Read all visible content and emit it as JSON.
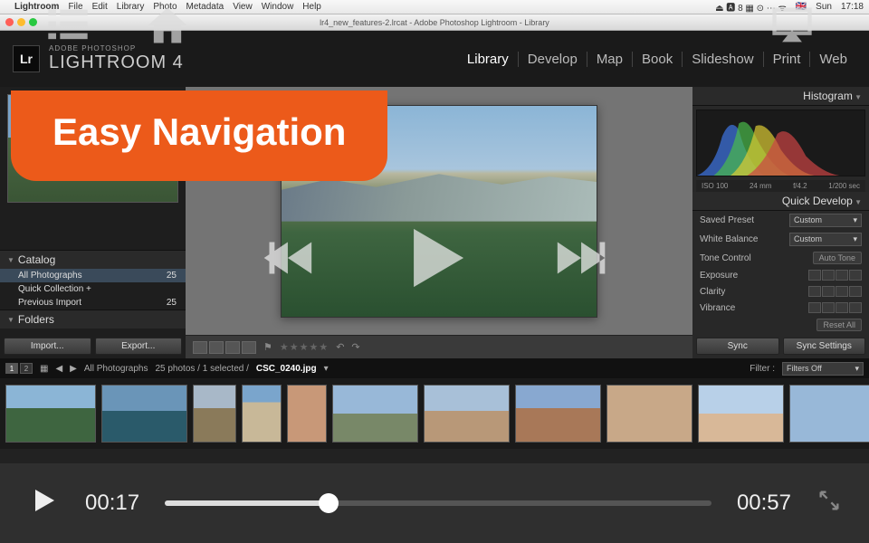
{
  "mac_menu": {
    "apple": "",
    "app": "Lightroom",
    "items": [
      "File",
      "Edit",
      "Library",
      "Photo",
      "Metadata",
      "View",
      "Window",
      "Help"
    ],
    "right": {
      "flag": "🇬🇧",
      "day": "Sun",
      "time": "17:18"
    }
  },
  "window_title": "lr4_new_features-2.lrcat - Adobe Photoshop Lightroom - Library",
  "lr": {
    "brand_top": "ADOBE PHOTOSHOP",
    "brand_main": "LIGHTROOM 4",
    "logo": "Lr",
    "modules": [
      "Library",
      "Develop",
      "Map",
      "Book",
      "Slideshow",
      "Print",
      "Web"
    ],
    "active_module": "Library",
    "left": {
      "catalog_label": "Catalog",
      "catalog": [
        {
          "name": "All Photographs",
          "count": "25",
          "selected": true
        },
        {
          "name": "Quick Collection  +",
          "count": "",
          "selected": false
        },
        {
          "name": "Previous Import",
          "count": "25",
          "selected": false
        }
      ],
      "folders_label": "Folders",
      "import_btn": "Import...",
      "export_btn": "Export..."
    },
    "right": {
      "histogram_label": "Histogram",
      "histo_info": {
        "iso": "ISO 100",
        "focal": "24 mm",
        "fstop": "f/4.2",
        "shutter": "1/200 sec"
      },
      "quickdev_label": "Quick Develop",
      "saved_preset_lbl": "Saved Preset",
      "saved_preset_val": "Custom",
      "wb_lbl": "White Balance",
      "wb_val": "Custom",
      "tone_lbl": "Tone Control",
      "autotone": "Auto Tone",
      "exposure_lbl": "Exposure",
      "clarity_lbl": "Clarity",
      "vibrance_lbl": "Vibrance",
      "reset_btn": "Reset All",
      "sync_btn": "Sync",
      "sync_settings_btn": "Sync Settings"
    },
    "filmstrip_head": {
      "path": "All Photographs",
      "info": "25 photos / 1 selected /",
      "file": "CSC_0240.jpg",
      "filter_lbl": "Filter :",
      "filter_val": "Filters Off"
    }
  },
  "callout_text": "Easy Navigation",
  "player": {
    "current": "00:17",
    "total": "00:57",
    "progress_pct": 30
  }
}
